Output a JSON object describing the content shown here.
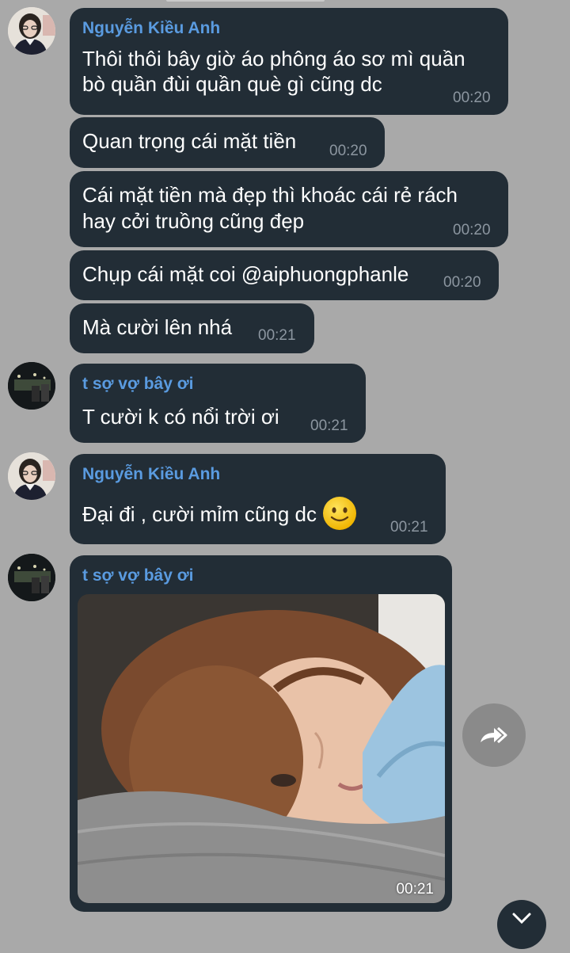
{
  "messages": [
    {
      "sender": "Nguyễn Kiều Anh",
      "lines": [
        "Thôi thôi bây giờ áo phông áo sơ mì quần",
        "bò quần đùi quần què gì cũng dc"
      ],
      "time": "00:20"
    },
    {
      "text": "Quan trọng cái mặt tiền",
      "time": "00:20"
    },
    {
      "lines": [
        "Cái mặt tiền mà đẹp thì khoác cái rẻ rách",
        "hay cởi truồng cũng đẹp"
      ],
      "time": "00:20"
    },
    {
      "text": "Chụp cái mặt coi @aiphuongphanle",
      "time": "00:20"
    },
    {
      "text": "Mà cười lên nhá",
      "time": "00:21"
    },
    {
      "sender": "t sợ vợ bây ơi",
      "text": "T cười k có nổi trời ơi",
      "time": "00:21"
    },
    {
      "sender": "Nguyễn Kiều Anh",
      "text": "Đại đi , cười mỉm cũng dc",
      "emoji": "slightly-smiling-face",
      "time": "00:21"
    },
    {
      "sender": "t sợ vợ bây ơi",
      "media": "photo",
      "time": "00:21"
    }
  ],
  "colors": {
    "background": "#a9a9a9",
    "bubble": "#222d36",
    "sender_name": "#5a9be0",
    "timestamp": "#8c96a0"
  },
  "icons": {
    "share": "forward-arrow-icon",
    "scroll": "chevron-down-icon"
  }
}
